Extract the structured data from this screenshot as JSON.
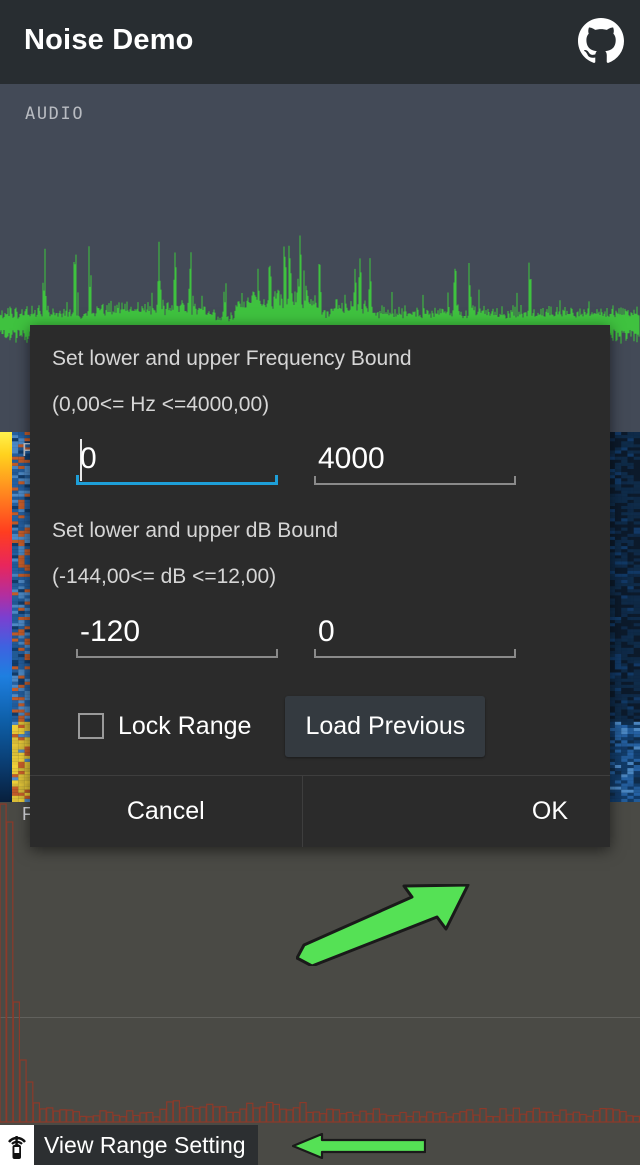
{
  "header": {
    "title": "Noise Demo",
    "github_icon": "github-icon"
  },
  "panels": {
    "waveform": {
      "label": "AUDIO",
      "wave_color": "#3FC23F",
      "background": "#434A57"
    },
    "spectrogram": {
      "label": "F",
      "background": "#0C1A2B"
    },
    "spectrum": {
      "label": "F",
      "bar_color": "#8C3A2A",
      "background": "#4A4A45"
    }
  },
  "dialog": {
    "freq_title": "Set lower and upper Frequency Bound",
    "freq_range": "(0,00<= Hz <=4000,00)",
    "freq_lower_value": "0",
    "freq_upper_value": "4000",
    "db_title": "Set lower and upper dB Bound",
    "db_range": "(-144,00<= dB <=12,00)",
    "db_lower_value": "-120",
    "db_upper_value": "0",
    "lock_range_label": "Lock Range",
    "lock_range_checked": false,
    "load_previous_label": "Load Previous",
    "cancel_label": "Cancel",
    "ok_label": "OK",
    "focus_accent": "#1E9FD8",
    "background": "#2B2B2B"
  },
  "bottom_bar": {
    "app_icon": "microphone-signal-icon",
    "label": "View Range Setting",
    "background": "#2C2F31"
  },
  "annotations": {
    "arrow_color": "#55E155",
    "arrow_to_ok": "arrow-pointing-to-ok",
    "arrow_to_menu": "arrow-pointing-to-view-range-setting"
  }
}
